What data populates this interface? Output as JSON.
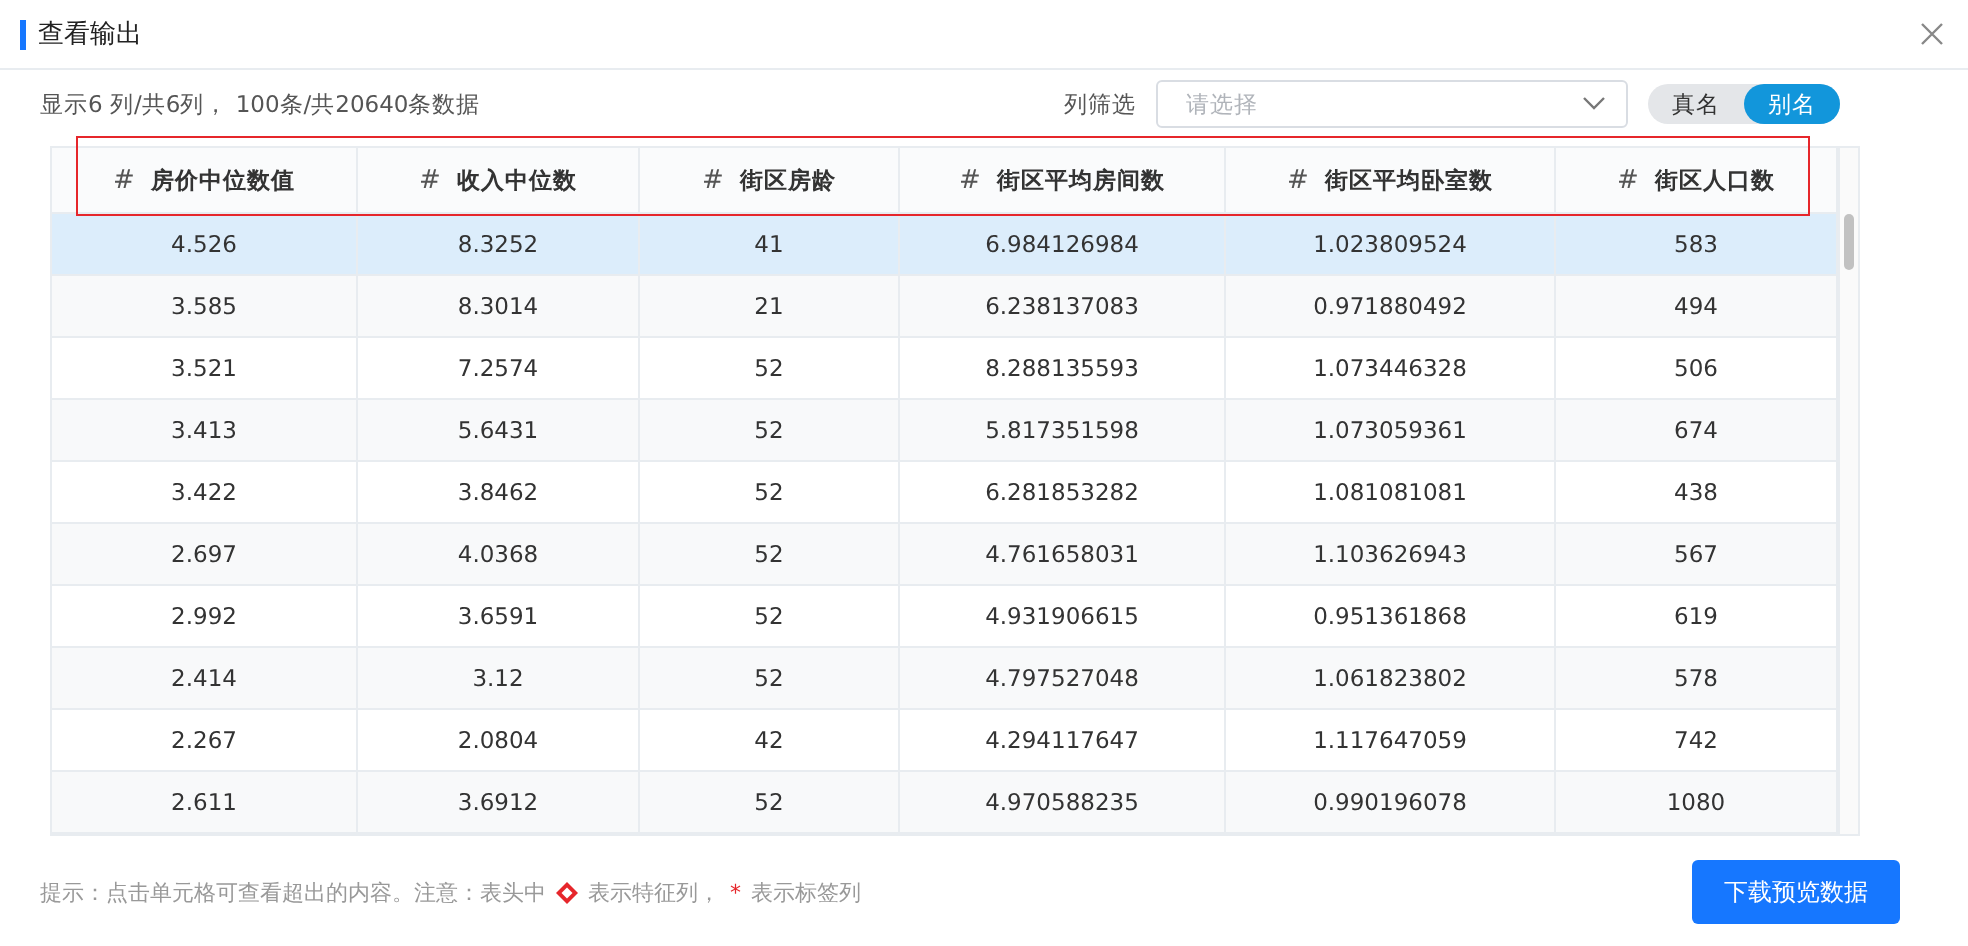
{
  "window": {
    "title": "查看输出"
  },
  "summary": "显示6 列/共6列， 100条/共20640条数据",
  "filter": {
    "label": "列筛选",
    "placeholder": "请选择"
  },
  "name_toggle": [
    {
      "label": "真名",
      "selected": false
    },
    {
      "label": "别名",
      "selected": true
    }
  ],
  "table": {
    "header_highlighted": true,
    "columns": [
      {
        "icon": "#",
        "label": "房价中位数值"
      },
      {
        "icon": "#",
        "label": "收入中位数"
      },
      {
        "icon": "#",
        "label": "街区房龄"
      },
      {
        "icon": "#",
        "label": "街区平均房间数"
      },
      {
        "icon": "#",
        "label": "街区平均卧室数"
      },
      {
        "icon": "#",
        "label": "街区人口数"
      }
    ],
    "rows": [
      {
        "selected": true,
        "cells": [
          "4.526",
          "8.3252",
          "41",
          "6.984126984",
          "1.023809524",
          "583"
        ]
      },
      {
        "selected": false,
        "cells": [
          "3.585",
          "8.3014",
          "21",
          "6.238137083",
          "0.971880492",
          "494"
        ]
      },
      {
        "selected": false,
        "cells": [
          "3.521",
          "7.2574",
          "52",
          "8.288135593",
          "1.073446328",
          "506"
        ]
      },
      {
        "selected": false,
        "cells": [
          "3.413",
          "5.6431",
          "52",
          "5.817351598",
          "1.073059361",
          "674"
        ]
      },
      {
        "selected": false,
        "cells": [
          "3.422",
          "3.8462",
          "52",
          "6.281853282",
          "1.081081081",
          "438"
        ]
      },
      {
        "selected": false,
        "cells": [
          "2.697",
          "4.0368",
          "52",
          "4.761658031",
          "1.103626943",
          "567"
        ]
      },
      {
        "selected": false,
        "cells": [
          "2.992",
          "3.6591",
          "52",
          "4.931906615",
          "0.951361868",
          "619"
        ]
      },
      {
        "selected": false,
        "cells": [
          "2.414",
          "3.12",
          "52",
          "4.797527048",
          "1.061823802",
          "578"
        ]
      },
      {
        "selected": false,
        "cells": [
          "2.267",
          "2.0804",
          "42",
          "4.294117647",
          "1.117647059",
          "742"
        ]
      },
      {
        "selected": false,
        "cells": [
          "2.611",
          "3.6912",
          "52",
          "4.970588235",
          "0.990196078",
          "1080"
        ]
      }
    ]
  },
  "hint": {
    "part_1": "提示：点击单元格可查看超出的内容。注意：表头中",
    "part_2": "表示特征列，",
    "mark": "*",
    "part_3": "表示标签列"
  },
  "download_button": "下载预览数据"
}
